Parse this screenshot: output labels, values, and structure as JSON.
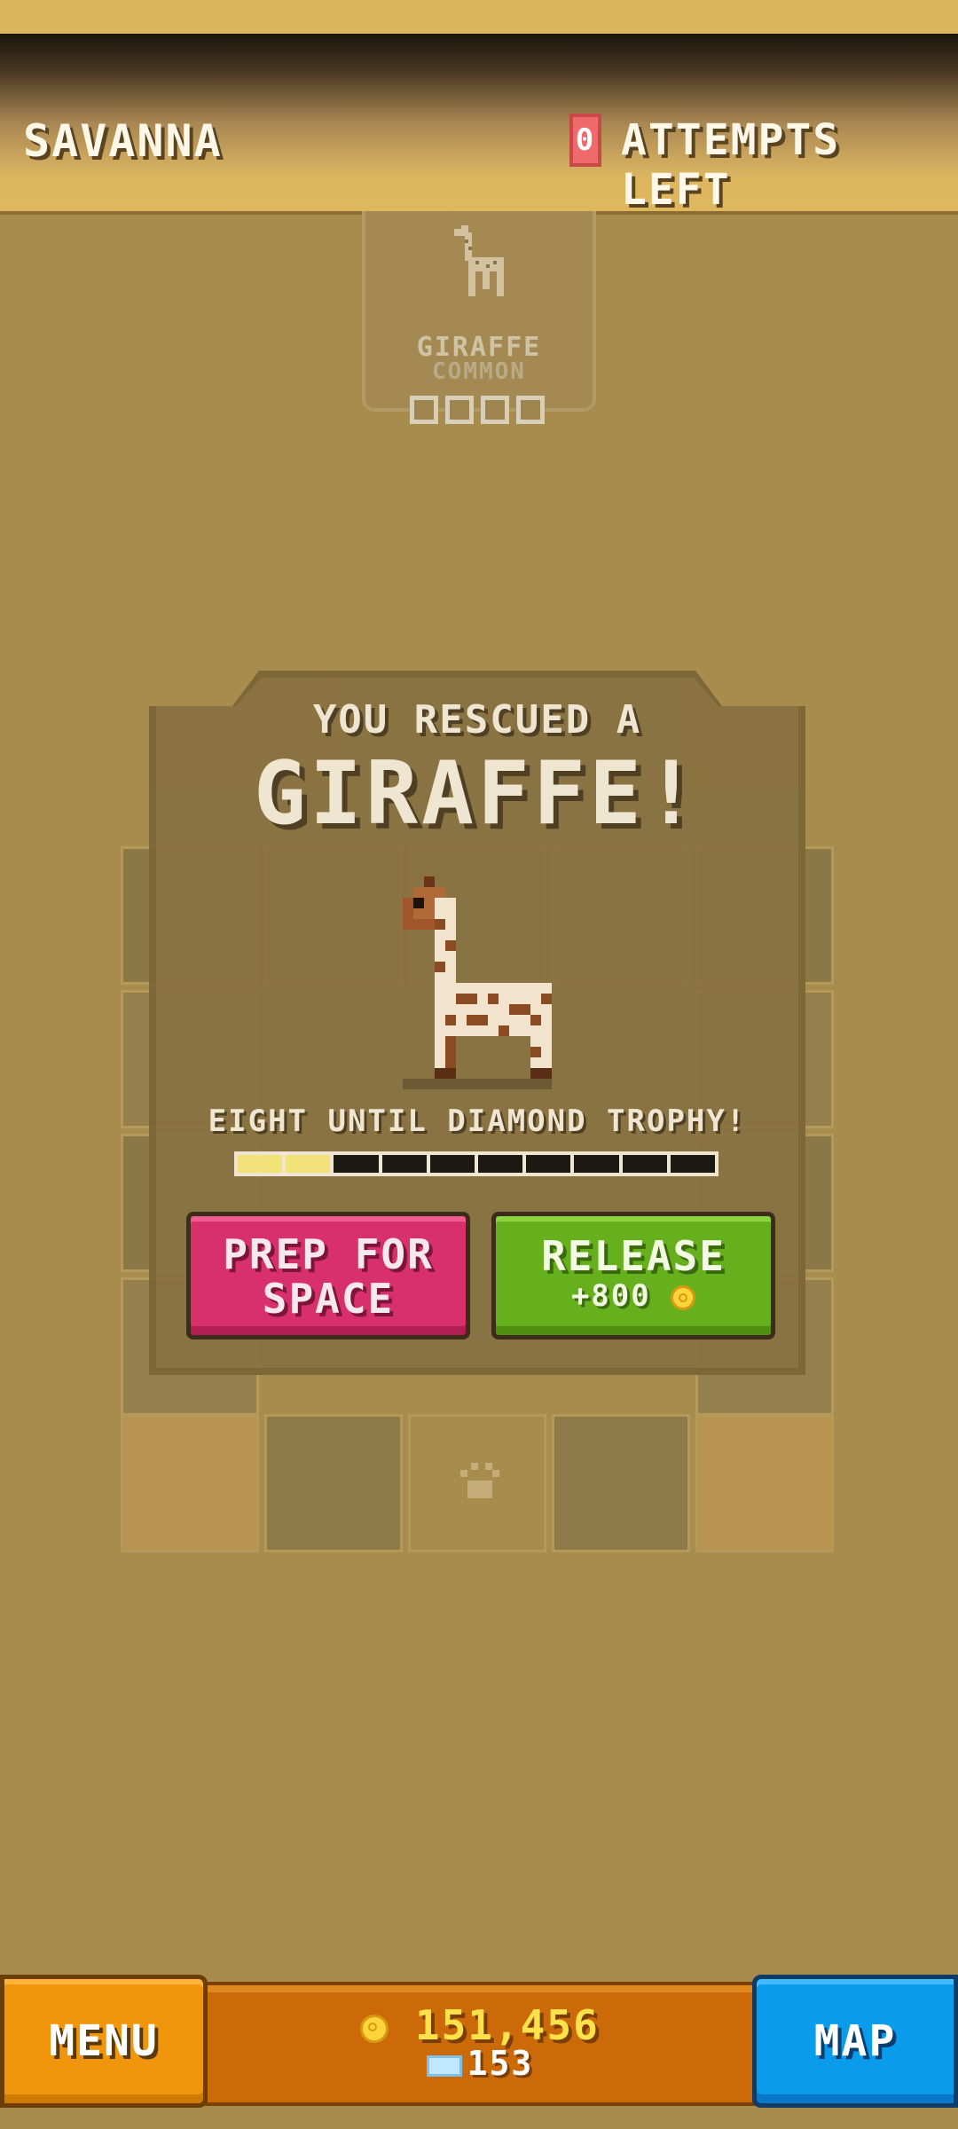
{
  "header": {
    "level_name": "SAVANNA",
    "attempts_count": "0",
    "attempts_label": "ATTEMPTS LEFT"
  },
  "collected_card": {
    "name": "GIRAFFE",
    "rarity": "COMMON",
    "icon": "giraffe-icon",
    "slots": 4
  },
  "modal": {
    "subtitle": "YOU RESCUED A",
    "title": "GIRAFFE!",
    "animal_icon": "giraffe-sprite",
    "progress_text": "EIGHT UNTIL DIAMOND TROPHY!",
    "progress": {
      "filled": 2,
      "total": 10
    },
    "prep_button": {
      "line1": "PREP FOR",
      "line2": "SPACE"
    },
    "release_button": {
      "label": "RELEASE",
      "reward": "+800"
    }
  },
  "bottom_bar": {
    "menu_label": "MENU",
    "coins": "151,456",
    "gems": "153",
    "map_label": "MAP"
  },
  "colors": {
    "background": "#a88c4e",
    "prep_button": "#d8306a",
    "release_button": "#66b01e",
    "menu_button": "#f0950c",
    "map_button": "#0a9bea",
    "coin": "#ffd43a",
    "progress_fill": "#f3e27a"
  }
}
